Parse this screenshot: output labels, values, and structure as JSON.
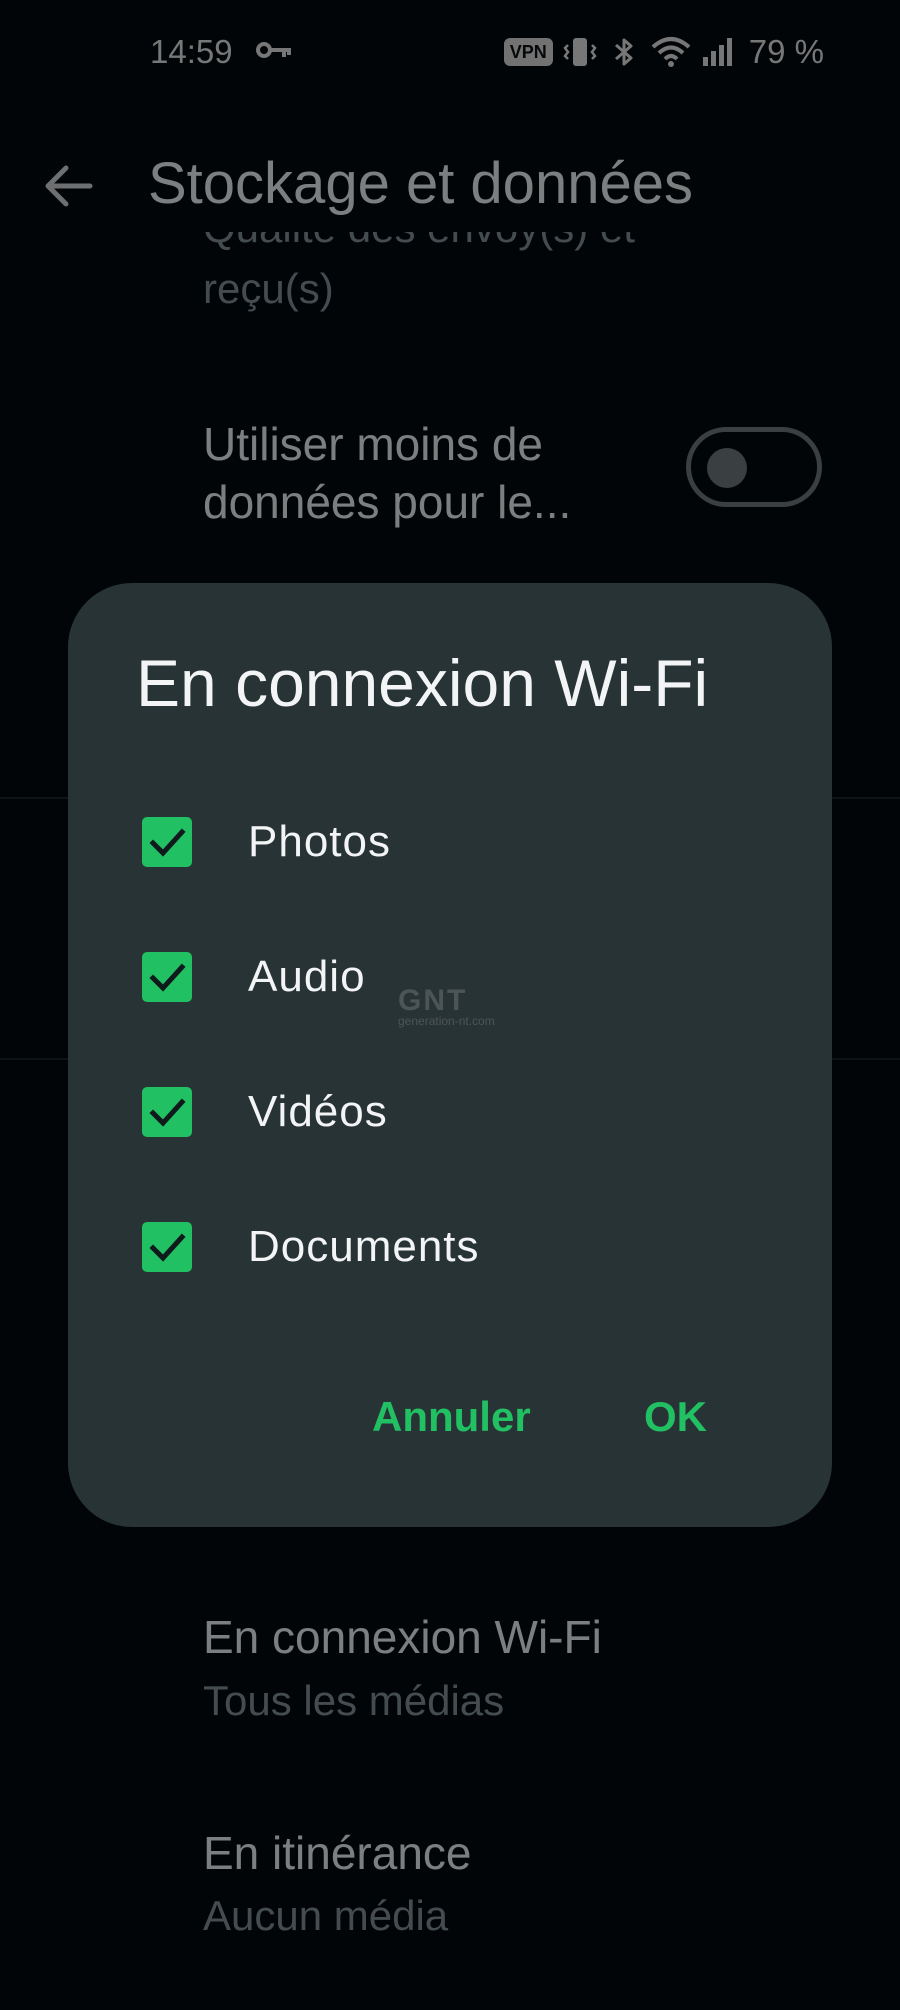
{
  "status_bar": {
    "time": "14:59",
    "vpn": "VPN",
    "battery": "79 %",
    "icons": [
      "key-icon",
      "vibrate-icon",
      "bluetooth-icon",
      "wifi-icon",
      "signal-icon"
    ]
  },
  "app_bar": {
    "title": "Stockage et données",
    "back_icon": "arrow-left-icon"
  },
  "settings": {
    "clipped_line": "Qualité des envoy(s) et",
    "received": "reçu(s)",
    "less_data_line1": "Utiliser moins de",
    "less_data_line2": "données pour le...",
    "less_data_enabled": false,
    "wifi_title": "En connexion Wi-Fi",
    "wifi_value": "Tous les médias",
    "roaming_title": "En itinérance",
    "roaming_value": "Aucun média"
  },
  "dialog": {
    "title": "En connexion Wi-Fi",
    "options": [
      {
        "label": "Photos",
        "checked": true
      },
      {
        "label": "Audio",
        "checked": true
      },
      {
        "label": "Vidéos",
        "checked": true
      },
      {
        "label": "Documents",
        "checked": true
      }
    ],
    "cancel_label": "Annuler",
    "ok_label": "OK"
  },
  "watermark": {
    "text": "GNT",
    "sub": "generation-nt.com"
  },
  "colors": {
    "accent": "#21c063",
    "dialog_bg": "#283335",
    "background": "#040a0d"
  }
}
